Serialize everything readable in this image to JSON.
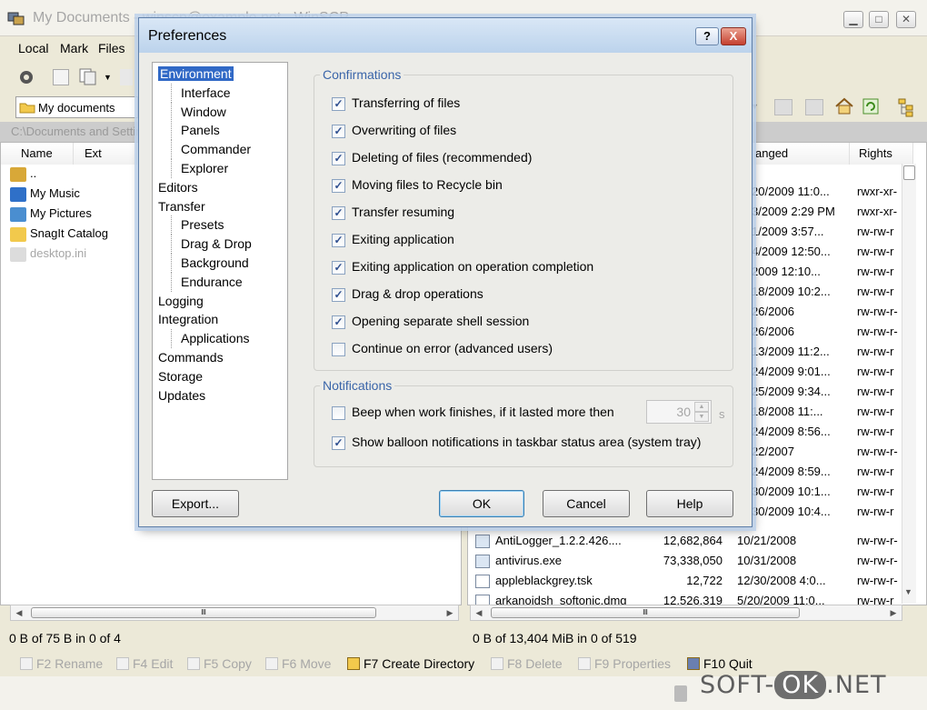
{
  "main_window": {
    "title": "My Documents - winscp@example.net - WinSCP",
    "menu": [
      "Local",
      "Mark",
      "Files"
    ],
    "address": "My documents",
    "left_path": "C:\\Documents and Settings",
    "left_columns": [
      "Name",
      "Ext"
    ],
    "left_files": [
      {
        "name": "..",
        "icon": "parent-dir-icon"
      },
      {
        "name": "My Music",
        "icon": "music-folder-icon"
      },
      {
        "name": "My Pictures",
        "icon": "pictures-folder-icon"
      },
      {
        "name": "SnagIt Catalog",
        "icon": "folder-icon"
      },
      {
        "name": "desktop.ini",
        "icon": "ini-file-icon"
      }
    ],
    "right_columns": [
      "anged",
      "Rights"
    ],
    "right_rows_partial": [
      {
        "changed": "20/2009 11:0...",
        "rights": "rwxr-xr-"
      },
      {
        "changed": "3/2009 2:29 PM",
        "rights": "rwxr-xr-"
      },
      {
        "changed": "1/2009 3:57...",
        "rights": "rw-rw-r"
      },
      {
        "changed": "4/2009 12:50...",
        "rights": "rw-rw-r"
      },
      {
        "changed": "2009 12:10...",
        "rights": "rw-rw-r"
      },
      {
        "changed": "18/2009 10:2...",
        "rights": "rw-rw-r"
      },
      {
        "changed": "26/2006",
        "rights": "rw-rw-r-"
      },
      {
        "changed": "26/2006",
        "rights": "rw-rw-r-"
      },
      {
        "changed": "13/2009 11:2...",
        "rights": "rw-rw-r"
      },
      {
        "changed": "24/2009 9:01...",
        "rights": "rw-rw-r"
      },
      {
        "changed": "25/2009 9:34...",
        "rights": "rw-rw-r"
      },
      {
        "changed": "18/2008 11:...",
        "rights": "rw-rw-r"
      },
      {
        "changed": "24/2009 8:56...",
        "rights": "rw-rw-r"
      },
      {
        "changed": "22/2007",
        "rights": "rw-rw-r-"
      },
      {
        "changed": "24/2009 8:59...",
        "rights": "rw-rw-r"
      },
      {
        "changed": "30/2009 10:1...",
        "rights": "rw-rw-r"
      },
      {
        "changed": "30/2009 10:4...",
        "rights": "rw-rw-r"
      }
    ],
    "right_rows_full": [
      {
        "name": "AntiLogger_1.2.2.426....",
        "size": "12,682,864",
        "changed": "10/21/2008",
        "rights": "rw-rw-r-",
        "icon": "exe-file-icon"
      },
      {
        "name": "antivirus.exe",
        "size": "73,338,050",
        "changed": "10/31/2008",
        "rights": "rw-rw-r-",
        "icon": "exe-file-icon"
      },
      {
        "name": "appleblackgrey.tsk",
        "size": "12,722",
        "changed": "12/30/2008 4:0...",
        "rights": "rw-rw-r-",
        "icon": "file-icon"
      },
      {
        "name": "arkanoidsh_softonic.dmg",
        "size": "12,526,319",
        "changed": "5/20/2009 11:0...",
        "rights": "rw-rw-r",
        "icon": "file-icon"
      }
    ],
    "left_status": "0 B of 75 B in 0 of 4",
    "right_status": "0 B of 13,404 MiB in 0 of 519",
    "fkeys": [
      {
        "label": "F2 Rename",
        "enabled": false,
        "icon": "rename-icon"
      },
      {
        "label": "F4 Edit",
        "enabled": false,
        "icon": "edit-icon"
      },
      {
        "label": "F5 Copy",
        "enabled": false,
        "icon": "copy-icon"
      },
      {
        "label": "F6 Move",
        "enabled": false,
        "icon": "move-icon"
      },
      {
        "label": "F7 Create Directory",
        "enabled": true,
        "icon": "new-folder-icon"
      },
      {
        "label": "F8 Delete",
        "enabled": false,
        "icon": "delete-icon"
      },
      {
        "label": "F9 Properties",
        "enabled": false,
        "icon": "properties-icon"
      },
      {
        "label": "F10 Quit",
        "enabled": true,
        "icon": "quit-icon"
      }
    ],
    "watermark_left": "SOFT-",
    "watermark_ok": "OK",
    "watermark_right": ".NET"
  },
  "dialog": {
    "title": "Preferences",
    "help_button": "?",
    "close_button": "X",
    "tree": [
      {
        "label": "Environment",
        "level": 0,
        "selected": true
      },
      {
        "label": "Interface",
        "level": 1
      },
      {
        "label": "Window",
        "level": 1
      },
      {
        "label": "Panels",
        "level": 1
      },
      {
        "label": "Commander",
        "level": 1
      },
      {
        "label": "Explorer",
        "level": 1
      },
      {
        "label": "Editors",
        "level": 0
      },
      {
        "label": "Transfer",
        "level": 0
      },
      {
        "label": "Presets",
        "level": 1
      },
      {
        "label": "Drag & Drop",
        "level": 1
      },
      {
        "label": "Background",
        "level": 1
      },
      {
        "label": "Endurance",
        "level": 1
      },
      {
        "label": "Logging",
        "level": 0
      },
      {
        "label": "Integration",
        "level": 0
      },
      {
        "label": "Applications",
        "level": 1
      },
      {
        "label": "Commands",
        "level": 0
      },
      {
        "label": "Storage",
        "level": 0
      },
      {
        "label": "Updates",
        "level": 0
      }
    ],
    "confirmations": {
      "legend": "Confirmations",
      "items": [
        {
          "label": "Transferring of files",
          "checked": true
        },
        {
          "label": "Overwriting of files",
          "checked": true
        },
        {
          "label": "Deleting of files (recommended)",
          "checked": true
        },
        {
          "label": "Moving files to Recycle bin",
          "checked": true
        },
        {
          "label": "Transfer resuming",
          "checked": true
        },
        {
          "label": "Exiting application",
          "checked": true
        },
        {
          "label": "Exiting application on operation completion",
          "checked": true
        },
        {
          "label": "Drag & drop operations",
          "checked": true
        },
        {
          "label": "Opening separate shell session",
          "checked": true
        },
        {
          "label": "Continue on error (advanced users)",
          "checked": false
        }
      ]
    },
    "notifications": {
      "legend": "Notifications",
      "beep_label": "Beep when work finishes, if it lasted more then",
      "beep_checked": false,
      "beep_seconds": "30",
      "beep_unit": "s",
      "balloon_label": "Show balloon notifications in taskbar status area (system tray)",
      "balloon_checked": true
    },
    "buttons": {
      "export": "Export...",
      "ok": "OK",
      "cancel": "Cancel",
      "help": "Help"
    }
  },
  "colors": {
    "selection": "#3169c6",
    "legend": "#3a65a9",
    "disabled_text": "#a6a6a6"
  }
}
